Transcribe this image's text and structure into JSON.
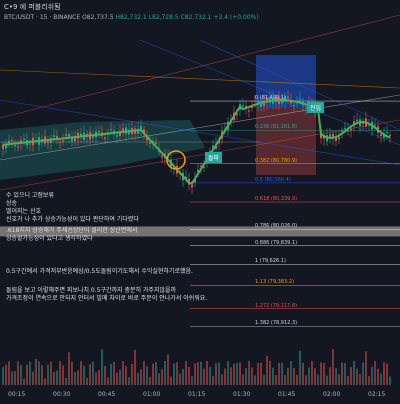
{
  "header": {
    "title": "C•9 에 퍼블리쉬됨",
    "symbol": "BTC/USDT · 15 · BINANCE",
    "ohlc_o": "O82,737.5",
    "ohlc_h": "H82,732.1",
    "ohlc_l": "L82,728.5",
    "ohlc_c": "C82,732.1",
    "change": "+3.4 (+0.00%)"
  },
  "chart_data": {
    "type": "candlestick",
    "fib_levels": [
      {
        "ratio": "0",
        "text": "0 (81,499.1)",
        "price": 81499.1,
        "color": "#d1d4dc"
      },
      {
        "ratio": "0.236",
        "text": "0.236 (81,161.6)",
        "price": 81161.6,
        "color": "#26a69a"
      },
      {
        "ratio": "0.382",
        "text": "0.382 (80,780.9)",
        "price": 80780.9,
        "color": "#ff9800"
      },
      {
        "ratio": "0.5",
        "text": "0.5 (80,560.4)",
        "price": 80560.4,
        "color": "#2962ff"
      },
      {
        "ratio": "0.618",
        "text": "0.618 (80,339.9)",
        "price": 80339.9,
        "color": "#ef5350"
      },
      {
        "ratio": "0.786",
        "text": "0.786 (80,026.0)",
        "price": 80026.0,
        "color": "#d1d4dc"
      },
      {
        "ratio": "0.886",
        "text": "0.886 (79,839.1)",
        "price": 79839.1,
        "color": "#d1d4dc"
      },
      {
        "ratio": "1",
        "text": "1 (79,626.1)",
        "price": 79626.1,
        "color": "#d1d4dc"
      },
      {
        "ratio": "1.13",
        "text": "1.13 (79,383.2)",
        "price": 79383.2,
        "color": "#ff9800"
      },
      {
        "ratio": "1.272",
        "text": "1.272 (79,117.8)",
        "price": 79117.8,
        "color": "#ef5350"
      },
      {
        "ratio": "1.382",
        "text": "1.382 (78,912.3)",
        "price": 78912.3,
        "color": "#d1d4dc"
      }
    ],
    "time_labels": [
      "00:15",
      "00:30",
      "00:45",
      "01:00",
      "01:15",
      "01:30",
      "01:45",
      "02:00",
      "02:15"
    ],
    "tags": {
      "entry": "진입",
      "break": "돌파"
    },
    "price_min": 78700,
    "price_max": 82200
  },
  "notes": [
    "수 있으니 고점보류",
    "상승",
    "떨어지는 신호",
    "신호가 나 추가 상승가능성이 있다 판단하여 기다렸다",
    ".618지지 상승해가 주세선상단이 클리한 상산면에서",
    "상승할가능성이 있다고 생각하였다",
    "0.5구간에서 가격저부반응예상/0.5도돌림이기도해서 수익실현하기로했음.",
    "돌림을 보고 이렇해주면 피보나치 0.5구간까지 충분히 가주지않을까",
    "가격조정이 연속으로 안되지 안터서 빌메 차이로 바로 주문이 안나가서 아쉬워요."
  ],
  "colors": {
    "background": "#131722",
    "up": "#26a69a",
    "down": "#ef5350",
    "accent": "#2962ff"
  }
}
